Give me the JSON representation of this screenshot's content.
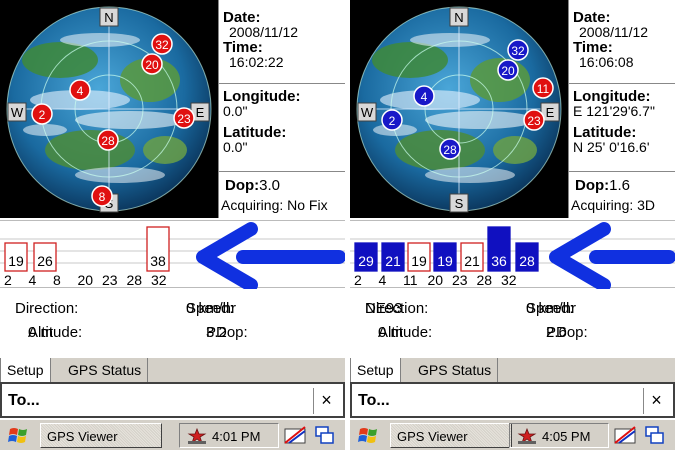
{
  "screens": [
    {
      "info": {
        "date_label": "Date:",
        "date": "2008/11/12",
        "time_label": "Time:",
        "time": "16:02:22",
        "longitude_label": "Longitude:",
        "longitude": "0.0\"",
        "latitude_label": "Latitude:",
        "latitude": "0.0\"",
        "dop_label": "Dop:",
        "dop": "3.0",
        "acquiring": "Acquiring: No Fix"
      },
      "compass": {
        "n": "N",
        "s": "S",
        "e": "E",
        "w": "W"
      },
      "satellites": [
        {
          "id": "32",
          "fix": "red"
        },
        {
          "id": "20",
          "fix": "red"
        },
        {
          "id": "4",
          "fix": "red"
        },
        {
          "id": "2",
          "fix": "red"
        },
        {
          "id": "23",
          "fix": "red"
        },
        {
          "id": "28",
          "fix": "red"
        },
        {
          "id": "8",
          "fix": "red"
        }
      ],
      "signal_boxes": [
        {
          "label": "19",
          "filled": false
        },
        {
          "label": "26",
          "filled": false
        },
        {
          "label": "38",
          "filled": false
        }
      ],
      "prn_labels": [
        "2",
        "4",
        "8",
        "20",
        "23",
        "28",
        "32"
      ],
      "stats": {
        "direction_label": "Direction:",
        "direction": "",
        "speed_label": "Speed:",
        "speed": "0 km/hr",
        "altitude_label": "Altitude:",
        "altitude": "0 m",
        "pdop_label": "PDop:",
        "pdop": "3.2"
      },
      "tabs": [
        "Setup",
        "GPS Status"
      ],
      "todo": "To...",
      "todo_close": "×",
      "taskbar": {
        "app": "GPS Viewer",
        "clock": "4:01 PM"
      }
    },
    {
      "info": {
        "date_label": "Date:",
        "date": "2008/11/12",
        "time_label": "Time:",
        "time": "16:06:08",
        "longitude_label": "Longitude:",
        "longitude": "E 121'29'6.7\"",
        "latitude_label": "Latitude:",
        "latitude": "N  25' 0'16.6'",
        "dop_label": "Dop:",
        "dop": "1.6",
        "acquiring": "Acquiring: 3D"
      },
      "compass": {
        "n": "N",
        "s": "S",
        "e": "E",
        "w": "W"
      },
      "satellites": [
        {
          "id": "32",
          "fix": "blue"
        },
        {
          "id": "20",
          "fix": "blue"
        },
        {
          "id": "11",
          "fix": "red"
        },
        {
          "id": "4",
          "fix": "blue"
        },
        {
          "id": "2",
          "fix": "blue"
        },
        {
          "id": "23",
          "fix": "red"
        },
        {
          "id": "28",
          "fix": "blue"
        }
      ],
      "signal_boxes": [
        {
          "label": "29",
          "filled": true
        },
        {
          "label": "21",
          "filled": true
        },
        {
          "label": "19",
          "filled": false
        },
        {
          "label": "19",
          "filled": true
        },
        {
          "label": "21",
          "filled": false
        },
        {
          "label": "36",
          "filled": true
        },
        {
          "label": "28",
          "filled": true
        }
      ],
      "prn_labels": [
        "2",
        "4",
        "11",
        "20",
        "23",
        "28",
        "32"
      ],
      "stats": {
        "direction_label": "Direction:",
        "direction": "NE93",
        "speed_label": "Speed:",
        "speed": "0 km/hr",
        "altitude_label": "Altitude:",
        "altitude": "0 m",
        "pdop_label": "PDop:",
        "pdop": "2.6"
      },
      "tabs": [
        "Setup",
        "GPS Status"
      ],
      "todo": "To...",
      "todo_close": "×",
      "taskbar": {
        "app": "GPS Viewer",
        "clock": "4:05 PM"
      }
    }
  ],
  "colors": {
    "fix_red": "#e01010",
    "fix_blue": "#1818c8",
    "signal_blue": "#1010c0",
    "arrow_blue": "#1030e0",
    "globe_ocean": "#1a6aa0",
    "taskbar": "#d4d0c8"
  }
}
